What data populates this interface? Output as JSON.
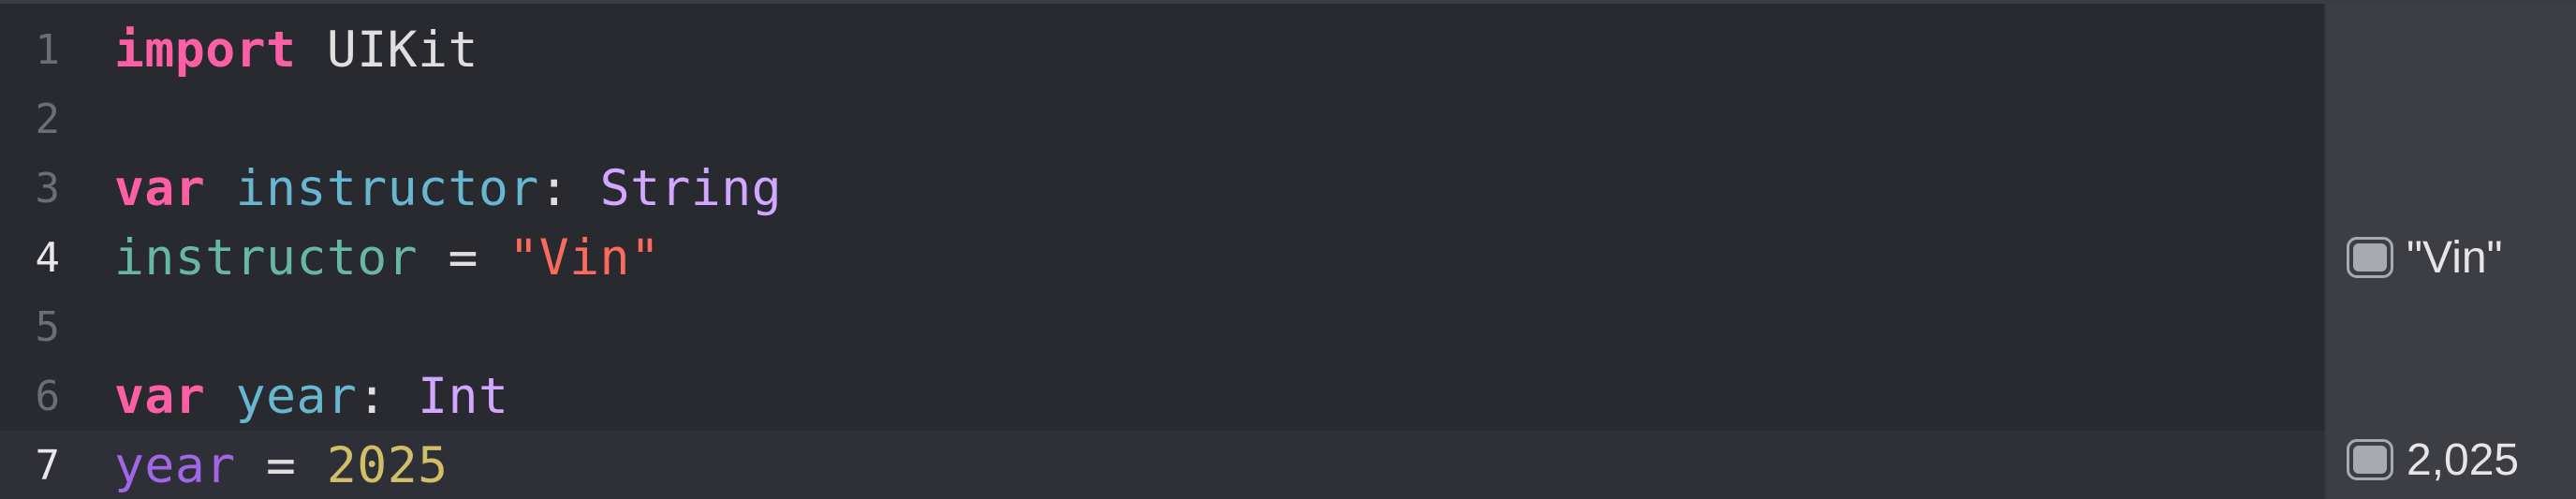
{
  "editor": {
    "lines": [
      {
        "number": "1",
        "tokens": [
          "import",
          " UIKit"
        ]
      },
      {
        "number": "2",
        "tokens": []
      },
      {
        "number": "3",
        "tokens": [
          "var",
          " ",
          "instructor",
          ": ",
          "String"
        ]
      },
      {
        "number": "4",
        "tokens": [
          "instructor",
          " = ",
          "\"Vin\""
        ]
      },
      {
        "number": "5",
        "tokens": []
      },
      {
        "number": "6",
        "tokens": [
          "var",
          " ",
          "year",
          ": ",
          "Int"
        ]
      },
      {
        "number": "7",
        "tokens": [
          "year",
          " = ",
          "2025"
        ]
      }
    ]
  },
  "results": {
    "line4": "\"Vin\"",
    "line7": "2,025"
  },
  "colors": {
    "keyword": "#fc5fa3",
    "string": "#fc6a5d",
    "number": "#d0bf69",
    "type": "#d0a8ff",
    "identifier": "#67b7a4",
    "background": "#292a30",
    "results_background": "#3d3e44"
  }
}
